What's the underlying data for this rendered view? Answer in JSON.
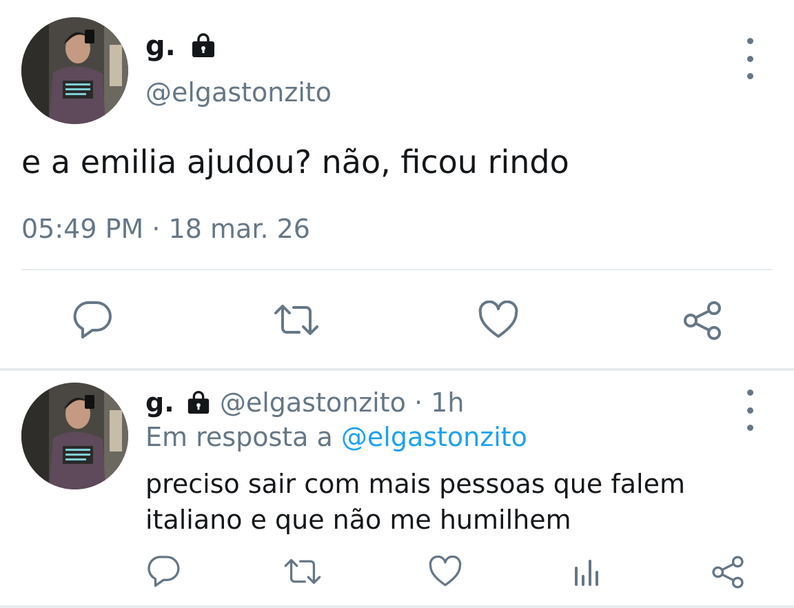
{
  "main_tweet": {
    "display_name": "g.",
    "handle": "@elgastonzito",
    "text": "e a emilia ajudou? não, ficou rindo",
    "time": "05:49 PM",
    "separator": "·",
    "date": "18 mar. 26",
    "actions": [
      "reply-icon",
      "retweet-icon",
      "like-icon",
      "share-icon"
    ]
  },
  "reply_tweet": {
    "display_name": "g.",
    "handle": "@elgastonzito",
    "separator": "·",
    "age": "1h",
    "reply_prefix": "Em resposta a",
    "reply_mention": "@elgastonzito",
    "text_line1": "preciso sair com mais pessoas que falem",
    "text_line2": "italiano e que não me humilhem",
    "actions": [
      "reply-icon",
      "retweet-icon",
      "like-icon",
      "analytics-icon",
      "share-icon"
    ]
  },
  "colors": {
    "text": "#14171a",
    "muted": "#657786",
    "link": "#1da1f2",
    "divider": "#e6ecf0"
  }
}
